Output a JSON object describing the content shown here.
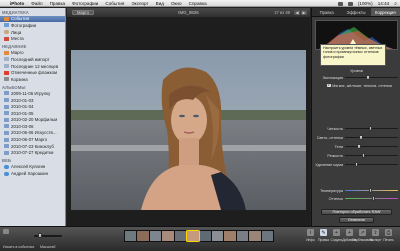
{
  "menubar": {
    "apple": "",
    "app_name": "iPhoto",
    "items": [
      "Файл",
      "Правка",
      "Фотографии",
      "События",
      "Экспорт",
      "Вид",
      "Окно",
      "Справка"
    ],
    "time": "14:44",
    "battery": "(100%)"
  },
  "sidebar": {
    "sections": [
      {
        "title": "МЕДИАТЕКА",
        "items": [
          {
            "label": "События",
            "icon": "event-icon",
            "selected": true
          },
          {
            "label": "Фотографии",
            "icon": "photos-icon"
          },
          {
            "label": "Лица",
            "icon": "faces-icon"
          },
          {
            "label": "Места",
            "icon": "places-icon"
          }
        ]
      },
      {
        "title": "НЕДАВНИЕ",
        "items": [
          {
            "label": "Марго",
            "icon": "event-icon"
          },
          {
            "label": "Последний импорт",
            "icon": "calendar-icon"
          },
          {
            "label": "Последние 12 месяцев",
            "icon": "calendar-icon"
          },
          {
            "label": "Отмеченные флажком",
            "icon": "flag-icon"
          },
          {
            "label": "Корзина",
            "icon": "trash-icon"
          }
        ]
      },
      {
        "title": "АЛЬБОМЫ",
        "items": [
          {
            "label": "2009-11-06 Игрулку",
            "icon": "album-icon"
          },
          {
            "label": "2010-01-03",
            "icon": "album-icon"
          },
          {
            "label": "2010-01-04",
            "icon": "album-icon"
          },
          {
            "label": "2010-01-05",
            "icon": "album-icon"
          },
          {
            "label": "2010-02-20 Морфильм",
            "icon": "album-icon"
          },
          {
            "label": "2010-03-06",
            "icon": "album-icon"
          },
          {
            "label": "2010-06-06 Искусств...",
            "icon": "album-icon"
          },
          {
            "label": "2010-06-07 Марго",
            "icon": "album-icon"
          },
          {
            "label": "2010-07-23 Киноклуб",
            "icon": "album-icon"
          },
          {
            "label": "2010-07-27 Кредитки",
            "icon": "album-icon"
          }
        ]
      },
      {
        "title": "ВЕБ",
        "items": [
          {
            "label": "Алексей Кулагин",
            "icon": "web-icon"
          },
          {
            "label": "Андрей Харошкин",
            "icon": "web-icon"
          }
        ]
      }
    ]
  },
  "viewer": {
    "back_label": "Марго",
    "title": "IMG_9826",
    "count": "17 из 49",
    "prev": "◀",
    "next": "▶"
  },
  "panel": {
    "tabs": [
      "Правка",
      "Эффекты",
      "Коррекция"
    ],
    "active_tab": 2,
    "histogram_colors": [
      "#3a6df0",
      "#3fcf4f",
      "#ff4a4a"
    ],
    "tooltip": "Настроить уровни тёмных, светлых тонов и промежуточных оттенков фотографии",
    "levels_label": "Уровни",
    "exposure_label": "Экспозиция",
    "check_label": "Мягкие, жёлткие, тени/св. оттенки",
    "sliders": [
      {
        "label": "Четкость",
        "value": 0.5
      },
      {
        "label": "Свето.-оттенки",
        "value": 0.3
      },
      {
        "label": "Тени",
        "value": 0.25
      },
      {
        "label": "Резкость",
        "value": 0.35
      },
      {
        "label": "Удаление шума",
        "value": 0.2
      }
    ],
    "temperature_label": "Температура",
    "tint_label": "Оттенок",
    "raw_button": "Повторно обработать RAW",
    "reset_button": "Отменить"
  },
  "bottombar": {
    "zoom_label": "Масштаб",
    "search_label": "Искать в событиях",
    "thumb_colors": [
      "#6f7a7e",
      "#8b6b5a",
      "#7c8590",
      "#a88b7a",
      "#6a7078",
      "#c69a7c",
      "#5f6a72",
      "#8a8f96",
      "#a07f6a",
      "#7b7f85",
      "#9a8677",
      "#6d757e"
    ],
    "selected_thumb": 5,
    "tools": [
      {
        "label": "Инфо",
        "icon": "info-icon",
        "glyph": "i"
      },
      {
        "label": "Правка",
        "icon": "edit-icon",
        "glyph": "✎",
        "active": true
      },
      {
        "label": "Создать",
        "icon": "create-icon",
        "glyph": "+"
      },
      {
        "label": "Добавить",
        "icon": "add-icon",
        "glyph": "+"
      },
      {
        "label": "Опубликовать",
        "icon": "share-icon",
        "glyph": "↗"
      },
      {
        "label": "Экспорт",
        "icon": "export-icon",
        "glyph": "⇪"
      },
      {
        "label": "Печать",
        "icon": "print-icon",
        "glyph": "⎙"
      }
    ]
  }
}
